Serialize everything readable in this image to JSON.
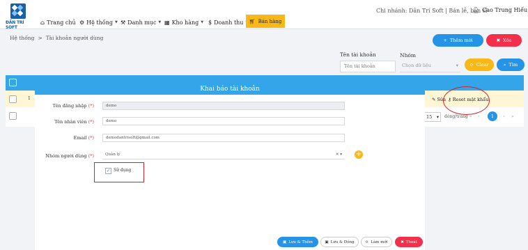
{
  "brand": {
    "logo_text": "ĐẦN TRÍ SOFT",
    "color": "#1a5fa8"
  },
  "nav": {
    "items": [
      {
        "label": "Trang chủ",
        "icon": "home-icon"
      },
      {
        "label": "Hệ thống",
        "icon": "gear-icon"
      },
      {
        "label": "Danh mục",
        "icon": "wrench-icon"
      },
      {
        "label": "Kho hàng",
        "icon": "warehouse-icon"
      },
      {
        "label": "Doanh thu",
        "icon": "dollar-icon"
      }
    ],
    "sell_label": "Bán hàng",
    "branch": "Chi nhánh: Dân Trí Soft | Bán lẻ, bán sỉ",
    "user": "Cao Trung Hiếu"
  },
  "breadcrumb": {
    "root": "Hệ thống",
    "sep": ">",
    "current": "Tài khoản người dùng"
  },
  "toolbar": {
    "add_label": "Thêm mới",
    "delete_label": "Xóa"
  },
  "filters": {
    "account_label": "Tên tài khoản",
    "account_placeholder": "Tên tài khoản",
    "group_label": "Nhóm",
    "group_placeholder": "Chọn dữ liệu",
    "clear_label": "Clear",
    "search_label": "Tìm"
  },
  "table": {
    "row_number": "1",
    "edit_label": "Sửa",
    "reset_label": "Reset mật khẩu",
    "page_size": "15",
    "page_size_suffix": "dòng/trang",
    "current_page": "1",
    "first": "«",
    "prev": "‹",
    "next": "›",
    "last": "»"
  },
  "modal": {
    "title": "Khai báo tài khoản",
    "username_label": "Tên đăng nhập",
    "username_value": "demo",
    "fullname_label": "Tên nhân viên",
    "fullname_value": "demo",
    "email_label": "Email",
    "email_value": "demodantrisoft@gmail.com",
    "group_label": "Nhóm người dùng",
    "group_value": "Quản lý",
    "required_mark": "(*)",
    "use_label": "Sử dụng",
    "use_checked": true,
    "save_add_label": "Lưu & Thêm",
    "save_close_label": "Lưu & Đóng",
    "reload_label": "Làm mới",
    "exit_label": "Thoát"
  },
  "colors": {
    "primary": "#2594e6",
    "warning": "#f8b817",
    "danger": "#f2304b",
    "header": "#34a5e8",
    "highlight": "#d3242b"
  }
}
